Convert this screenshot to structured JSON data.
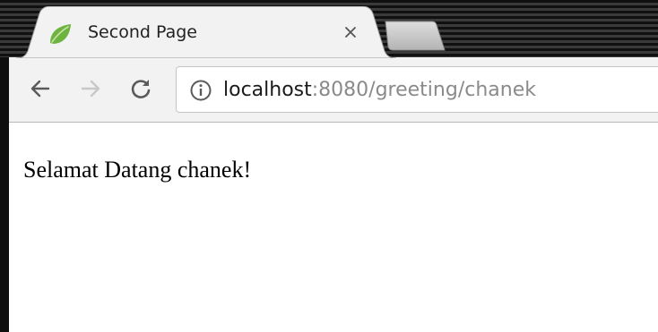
{
  "tab": {
    "title": "Second Page",
    "favicon": "spring-leaf-icon",
    "close_icon": "close-icon"
  },
  "toolbar": {
    "back_icon": "back-arrow-icon",
    "forward_icon": "forward-arrow-icon",
    "reload_icon": "reload-icon",
    "info_icon": "info-icon"
  },
  "address_bar": {
    "host": "localhost",
    "rest": ":8080/greeting/chanek"
  },
  "page": {
    "message": "Selamat Datang chanek!"
  },
  "colors": {
    "favicon_green": "#6db33f",
    "toolbar_bg": "#f2f2f2",
    "url_host": "#1a1a1a",
    "url_rest": "#8a8a8a"
  }
}
